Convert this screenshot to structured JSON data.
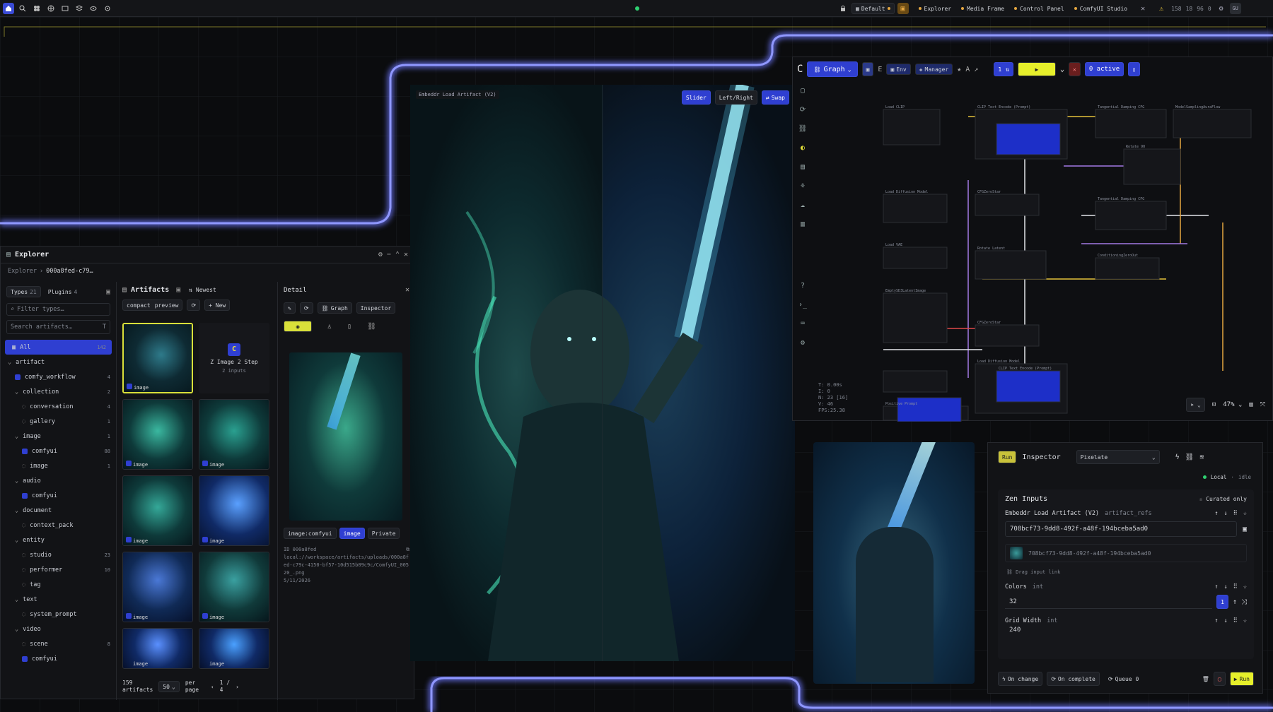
{
  "topbar": {
    "workspace": "Default",
    "links": [
      "Explorer",
      "Media Frame",
      "Control Panel",
      "ComfyUI Studio"
    ],
    "stats": [
      "158",
      "18",
      "96",
      "0"
    ]
  },
  "explorer": {
    "title": "Explorer",
    "breadcrumb_root": "Explorer",
    "breadcrumb_id": "000a8fed-c79…",
    "types_label": "Types",
    "types_count": "21",
    "plugins_label": "Plugins",
    "plugins_count": "4",
    "filter_placeholder": "Filter types…",
    "search_placeholder": "Search artifacts…",
    "tree": [
      {
        "label": "All",
        "count": "142",
        "depth": 0,
        "selected": true
      },
      {
        "label": "artifact",
        "count": "",
        "depth": 0,
        "caret": true
      },
      {
        "label": "comfy_workflow",
        "count": "4",
        "depth": 1,
        "icon": true
      },
      {
        "label": "collection",
        "count": "2",
        "depth": 1,
        "caret": true
      },
      {
        "label": "conversation",
        "count": "4",
        "depth": 2
      },
      {
        "label": "gallery",
        "count": "1",
        "depth": 2
      },
      {
        "label": "image",
        "count": "1",
        "depth": 1,
        "caret": true
      },
      {
        "label": "comfyui",
        "count": "88",
        "depth": 2,
        "icon": true
      },
      {
        "label": "image",
        "count": "1",
        "depth": 2
      },
      {
        "label": "audio",
        "count": "",
        "depth": 1,
        "caret": true
      },
      {
        "label": "comfyui",
        "count": "",
        "depth": 2,
        "icon": true
      },
      {
        "label": "document",
        "count": "",
        "depth": 1,
        "caret": true
      },
      {
        "label": "context_pack",
        "count": "",
        "depth": 2
      },
      {
        "label": "entity",
        "count": "",
        "depth": 1,
        "caret": true
      },
      {
        "label": "studio",
        "count": "23",
        "depth": 2
      },
      {
        "label": "performer",
        "count": "10",
        "depth": 2
      },
      {
        "label": "tag",
        "count": "",
        "depth": 2
      },
      {
        "label": "text",
        "count": "",
        "depth": 1,
        "caret": true
      },
      {
        "label": "system_prompt",
        "count": "",
        "depth": 2
      },
      {
        "label": "video",
        "count": "",
        "depth": 1,
        "caret": true
      },
      {
        "label": "scene",
        "count": "8",
        "depth": 2
      },
      {
        "label": "comfyui",
        "count": "",
        "depth": 2,
        "icon": true
      }
    ],
    "artifacts_title": "Artifacts",
    "sort_label": "Newest",
    "compact_label": "compact",
    "preview_label": "preview",
    "new_label": "+ New",
    "card_title": "Z Image 2 Step",
    "card_sub": "2 inputs",
    "thumb_badge": "image",
    "footer_count": "159",
    "footer_unit": "artifacts",
    "per_page_value": "50",
    "per_page_label": "per page",
    "page": "1 /",
    "page_total": "4"
  },
  "detail": {
    "title": "Detail",
    "graph_label": "Graph",
    "inspector_label": "Inspector",
    "tags": [
      "image:comfyui",
      "image",
      "Private"
    ],
    "id_line": "ID 000a8fed",
    "path": "local://workspace/artifacts/uploads/000a8fed-c79c-4150-bf57-10d515b09c9c/ComfyUI_00520_.png",
    "date": "5/11/2026"
  },
  "viewer": {
    "caption": "Embeddr Load Artifact (V2)",
    "slider_label": "Slider",
    "leftright_label": "Left/Right",
    "swap_label": "Swap"
  },
  "graph": {
    "graph_label": "Graph",
    "env_label": "Env",
    "manager_label": "Manager",
    "queue_value": "1",
    "active_label": "0 active",
    "zoom_label": "47%",
    "stats": [
      "T: 0.00s",
      "I: 0",
      "N: 23 [16]",
      "V: 46",
      "FPS:25.38"
    ],
    "nodes": [
      {
        "title": "Load CLIP"
      },
      {
        "title": "CLIP Text Encode (Prompt)"
      },
      {
        "title": "Tangential Damping CFG"
      },
      {
        "title": "ModelSamplingAuraFlow"
      },
      {
        "title": "Load Diffusion Model"
      },
      {
        "title": "Rotate 90"
      },
      {
        "title": "CFGZeroStar"
      },
      {
        "title": "Load VAE"
      },
      {
        "title": "Tangential Damping CFG"
      },
      {
        "title": "Rotate Latent"
      },
      {
        "title": "ConditioningZeroOut"
      },
      {
        "title": "EmptySD3LatentImage"
      },
      {
        "title": "CFGZeroStar"
      },
      {
        "title": "Load Diffusion Model"
      },
      {
        "title": "CLIP Text Encode (Prompt)"
      },
      {
        "title": "Positive Prompt"
      }
    ]
  },
  "inspector": {
    "run_chip": "Run",
    "title": "Inspector",
    "preset": "Pixelate",
    "local_label": "Local",
    "idle_label": "idle",
    "zen_inputs": "Zen Inputs",
    "curated_only": "Curated only",
    "artifact_node": "Embeddr Load Artifact (V2)",
    "artifact_refs": "artifact_refs",
    "artifact_uuid": "708bcf73-9dd8-492f-a48f-194bceba5ad0",
    "artifact_uuid_2": "708bcf73-9dd8-492f-a48f-194bceba5ad0",
    "drag_hint": "Drag input link",
    "colors_label": "Colors",
    "colors_type": "int",
    "colors_value": "32",
    "grid_label": "Grid Width",
    "grid_type": "int",
    "grid_value": "240",
    "step_value": "1",
    "on_change": "On change",
    "on_complete": "On complete",
    "queue_label": "Queue 0",
    "run_button": "Run"
  },
  "colors": {
    "accent": "#2f3fd1",
    "neon": "#6e78ff",
    "warning": "#e4c23a",
    "yellow_btn": "#e6ef2b"
  }
}
